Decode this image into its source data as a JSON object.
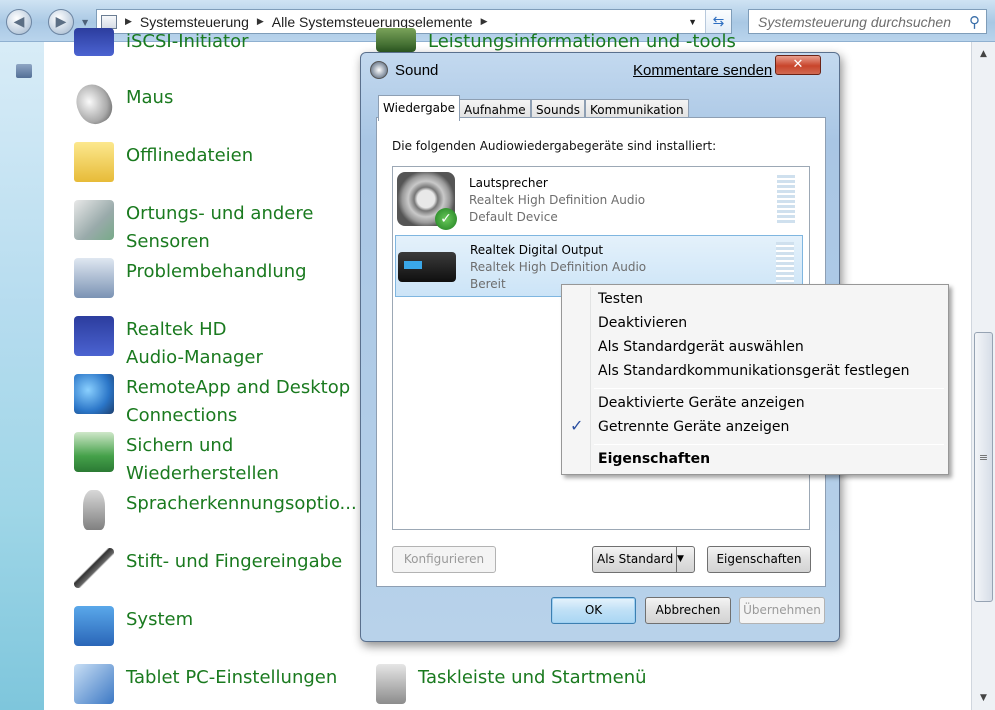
{
  "address": {
    "crumbs": [
      "Systemsteuerung",
      "Alle Systemsteuerungselemente"
    ],
    "search_placeholder": "Systemsteuerung durchsuchen"
  },
  "items": {
    "iscsi": "iSCSI-Initiator",
    "perf": "Leistungsinformationen und -tools",
    "maus": "Maus",
    "offline": "Offlinedateien",
    "ortung_1": "Ortungs- und andere",
    "ortung_2": "Sensoren",
    "problem": "Problembehandlung",
    "realtek_1": "Realtek HD",
    "realtek_2": "Audio-Manager",
    "remote_1": "RemoteApp and Desktop",
    "remote_2": "Connections",
    "sichern_1": "Sichern und",
    "sichern_2": "Wiederherstellen",
    "sprache": "Spracherkennungsoptio...",
    "stift": "Stift- und Fingereingabe",
    "system": "System",
    "tablet": "Tablet PC-Einstellungen",
    "taskleiste": "Taskleiste und Startmenü"
  },
  "dialog": {
    "title": "Sound",
    "feedback": "Kommentare senden",
    "tabs": [
      "Wiedergabe",
      "Aufnahme",
      "Sounds",
      "Kommunikation"
    ],
    "installed_label": "Die folgenden Audiowiedergabegeräte sind installiert:",
    "devices": [
      {
        "name": "Lautsprecher",
        "driver": "Realtek High Definition Audio",
        "status": "Default Device"
      },
      {
        "name": "Realtek Digital Output",
        "driver": "Realtek High Definition Audio",
        "status": "Bereit"
      }
    ],
    "buttons": {
      "configure": "Konfigurieren",
      "default": "Als Standard",
      "properties": "Eigenschaften",
      "ok": "OK",
      "cancel": "Abbrechen",
      "apply": "Übernehmen"
    }
  },
  "context_menu": {
    "items": [
      "Testen",
      "Deaktivieren",
      "Als Standardgerät auswählen",
      "Als Standardkommunikationsgerät festlegen",
      "Deaktivierte Geräte anzeigen",
      "Getrennte Geräte anzeigen",
      "Eigenschaften"
    ],
    "checked_item": "Getrennte Geräte anzeigen"
  }
}
